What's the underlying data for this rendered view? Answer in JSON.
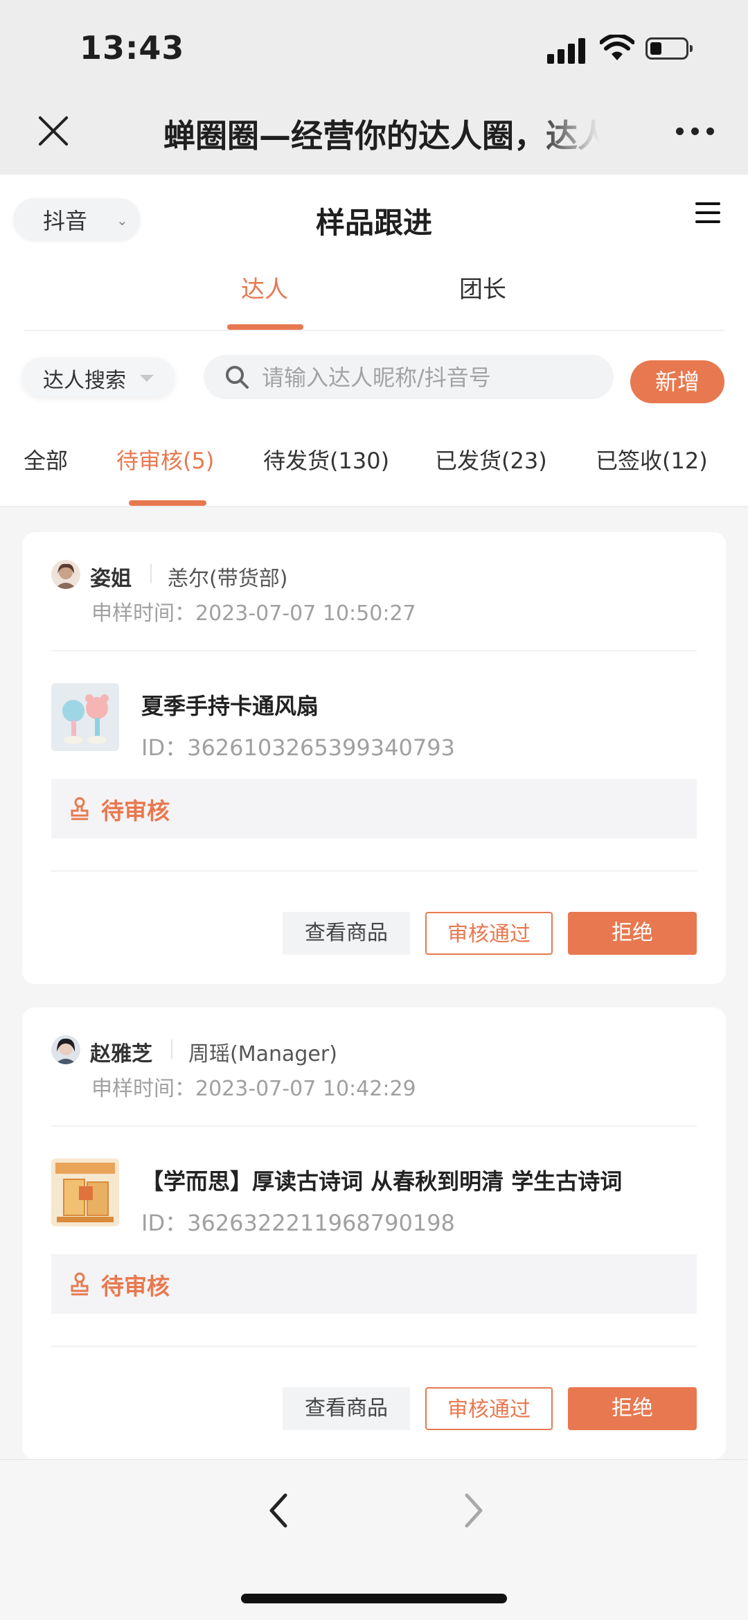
{
  "status_bar": {
    "time": "13:43"
  },
  "wechat": {
    "title": "蝉圈圈—经营你的达人圈，达人"
  },
  "header": {
    "platform": "抖音",
    "title": "样品跟进"
  },
  "tabs": [
    {
      "label": "达人",
      "active": true
    },
    {
      "label": "团长",
      "active": false
    }
  ],
  "search": {
    "type_label": "达人搜索",
    "placeholder": "请输入达人昵称/抖音号",
    "add_label": "新增"
  },
  "status_tabs": [
    {
      "label": "全部"
    },
    {
      "label": "待审核(5)",
      "active": true
    },
    {
      "label": "待发货(130)"
    },
    {
      "label": "已发货(23)"
    },
    {
      "label": "已签收(12)"
    }
  ],
  "cards": [
    {
      "user": "姿姐",
      "team": "恙尔(带货部)",
      "time_label": "申样时间：",
      "time": "2023-07-07 10:50:27",
      "product_name": "夏季手持卡通风扇",
      "product_id": "ID：3626103265399340793",
      "status": "待审核",
      "actions": {
        "view": "查看商品",
        "approve": "审核通过",
        "reject": "拒绝"
      }
    },
    {
      "user": "赵雅芝",
      "team": "周瑶(Manager)",
      "time_label": "申样时间：",
      "time": "2023-07-07 10:42:29",
      "product_name": "【学而思】厚读古诗词 从春秋到明清 学生古诗词",
      "product_id": "ID：3626322211968790198",
      "status": "待审核",
      "actions": {
        "view": "查看商品",
        "approve": "审核通过",
        "reject": "拒绝"
      }
    }
  ],
  "colors": {
    "accent": "#e8784f",
    "muted": "#a0a0a0"
  },
  "icons": [
    "close-icon",
    "more-icon",
    "menu-icon",
    "search-icon",
    "stamp-icon",
    "back-icon",
    "forward-icon"
  ]
}
